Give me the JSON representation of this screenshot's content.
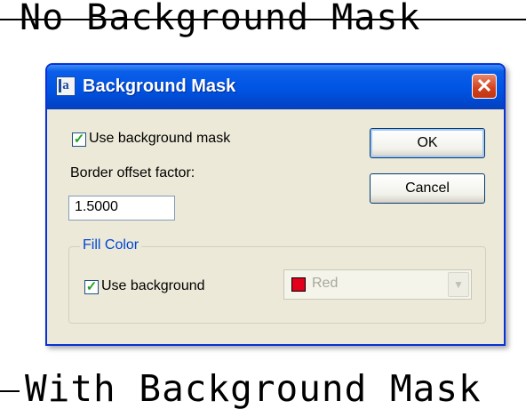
{
  "canvas": {
    "top_text": "No Background Mask",
    "bottom_text": "With Background Mask"
  },
  "dialog": {
    "title": "Background Mask",
    "app_icon_glyph": "a",
    "close_glyph": "✕",
    "use_background_mask": {
      "label": "Use background mask",
      "checked": true,
      "check_glyph": "✓"
    },
    "border_offset_label": "Border offset factor:",
    "border_offset_value": "1.5000",
    "ok_label": "OK",
    "cancel_label": "Cancel",
    "fill_color": {
      "legend": "Fill Color",
      "use_background": {
        "label": "Use background",
        "checked": true,
        "check_glyph": "✓"
      },
      "color_value": "Red",
      "color_hex": "#e3001b",
      "color_enabled": false,
      "dropdown_glyph": "▼"
    }
  }
}
